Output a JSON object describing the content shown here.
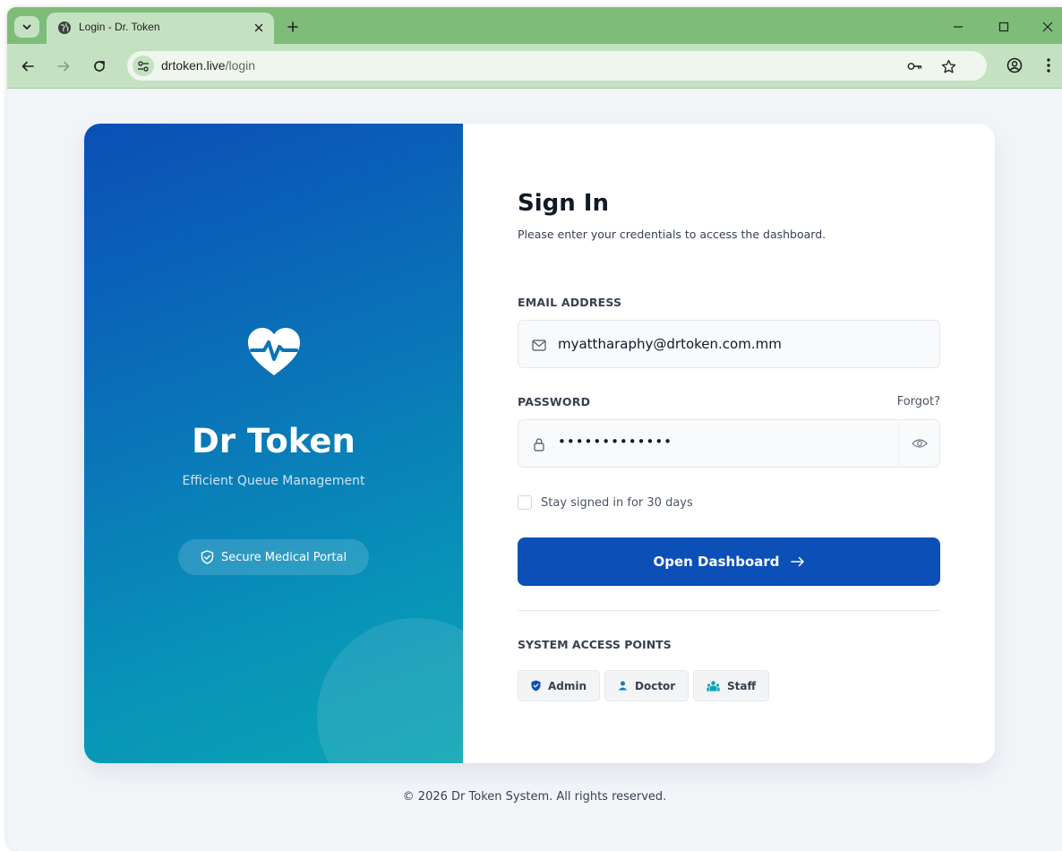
{
  "browser": {
    "tab_title": "Login - Dr. Token",
    "url_host": "drtoken.live",
    "url_path": "/login"
  },
  "brand": {
    "name": "Dr Token",
    "tagline": "Efficient Queue Management",
    "badge": "Secure Medical Portal"
  },
  "form": {
    "title": "Sign In",
    "subtitle": "Please enter your credentials to access the dashboard.",
    "email_label": "EMAIL ADDRESS",
    "email_value": "myattharaphy@drtoken.com.mm",
    "password_label": "PASSWORD",
    "forgot_label": "Forgot?",
    "password_mask": "•••••••••••••",
    "remember_label": "Stay signed in for 30 days",
    "remember_checked": false,
    "submit_label": "Open Dashboard",
    "access_title": "SYSTEM ACCESS POINTS",
    "access_points": [
      {
        "label": "Admin",
        "icon": "shield-icon"
      },
      {
        "label": "Doctor",
        "icon": "user-icon"
      },
      {
        "label": "Staff",
        "icon": "users-icon"
      }
    ]
  },
  "footer": {
    "text": "© 2026 Dr Token System. All rights reserved."
  },
  "colors": {
    "primary": "#0b4fb7",
    "teal": "#0aa5b3",
    "chrome_frame": "#7dbd79",
    "chrome_toolbar": "#c4e2c1"
  }
}
